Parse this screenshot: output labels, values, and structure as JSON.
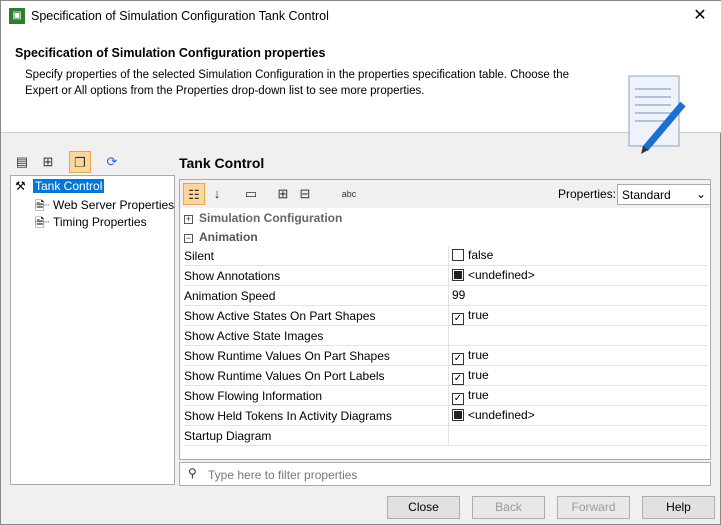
{
  "window": {
    "title": "Specification of Simulation Configuration Tank Control"
  },
  "header": {
    "title": "Specification of Simulation Configuration properties",
    "description": "Specify properties of the selected Simulation Configuration in the properties specification table. Choose the Expert or All options from the Properties drop-down list to see more properties."
  },
  "tree": {
    "root": "Tank Control",
    "children": [
      "Web Server Properties",
      "Timing Properties"
    ]
  },
  "panel": {
    "title": "Tank Control",
    "properties_label": "Properties:",
    "properties_value": "Standard"
  },
  "groups": {
    "sim": "Simulation Configuration",
    "anim": "Animation"
  },
  "rows": [
    {
      "name": "Silent",
      "state": "unchecked",
      "value": "false"
    },
    {
      "name": "Show Annotations",
      "state": "indeterminate",
      "value": "<undefined>"
    },
    {
      "name": "Animation Speed",
      "state": "none",
      "value": "99"
    },
    {
      "name": "Show Active States On Part Shapes",
      "state": "checked",
      "value": "true"
    },
    {
      "name": "Show Active State Images",
      "state": "none",
      "value": ""
    },
    {
      "name": "Show Runtime Values On Part Shapes",
      "state": "checked",
      "value": "true"
    },
    {
      "name": "Show Runtime Values On Port Labels",
      "state": "checked",
      "value": "true"
    },
    {
      "name": "Show Flowing Information",
      "state": "checked",
      "value": "true"
    },
    {
      "name": "Show Held Tokens In Activity Diagrams",
      "state": "indeterminate",
      "value": "<undefined>"
    },
    {
      "name": "Startup Diagram",
      "state": "none",
      "value": ""
    }
  ],
  "filter": {
    "placeholder": "Type here to filter properties"
  },
  "buttons": {
    "close": "Close",
    "back": "Back",
    "forward": "Forward",
    "help": "Help"
  }
}
